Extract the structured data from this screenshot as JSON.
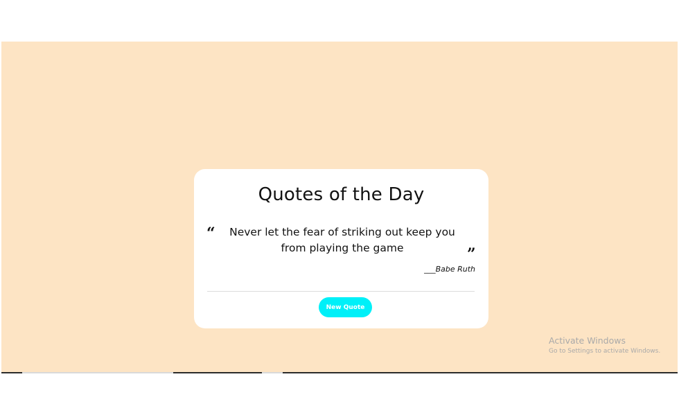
{
  "card": {
    "title": "Quotes of the Day",
    "open_quote_mark": "“",
    "close_quote_mark": "”",
    "quote_text": "Never let the fear of striking out keep you from playing the game",
    "author_prefix": "___",
    "author_name": "Babe Ruth",
    "new_quote_label": "New Quote"
  },
  "watermark": {
    "title": "Activate Windows",
    "subtitle": "Go to Settings to activate Windows."
  },
  "colors": {
    "page_background": "#fde4c4",
    "card_background": "#ffffff",
    "button_background": "#00f0f8",
    "button_text": "#ffffff"
  }
}
